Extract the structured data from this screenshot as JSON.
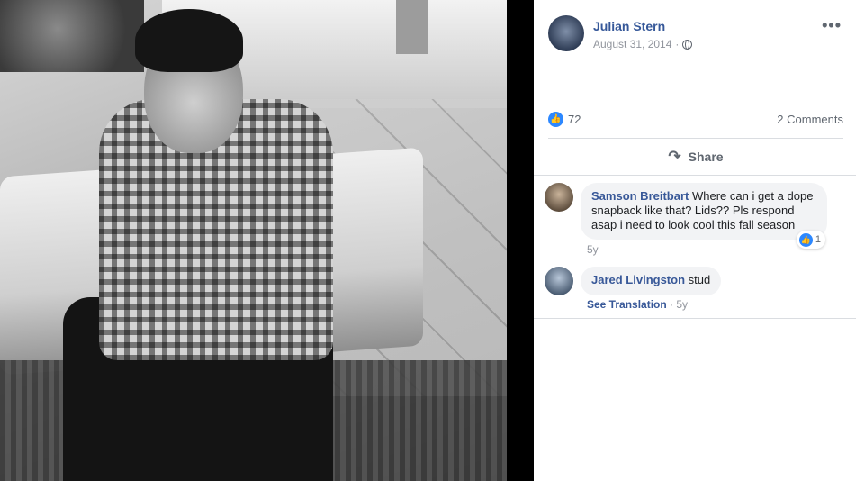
{
  "post": {
    "author": "Julian Stern",
    "date": "August 31, 2014",
    "privacy_icon": "globe-icon",
    "more_icon": "•••",
    "like_count": "72",
    "comments_count": "2 Comments",
    "share_label": "Share",
    "share_icon": "↷"
  },
  "comments": [
    {
      "author": "Samson Breitbart",
      "text": "Where can i get a dope snapback like that? Lids?? Pls respond asap i need to look cool this fall season",
      "time": "5y",
      "reaction_count": "1"
    },
    {
      "author": "Jared Livingston",
      "text": "stud",
      "see_translation": "See Translation",
      "separator": " · ",
      "time": "5y"
    }
  ],
  "colors": {
    "link_blue": "#365899",
    "like_blue": "#2d88ff",
    "muted_text": "#90949c"
  }
}
